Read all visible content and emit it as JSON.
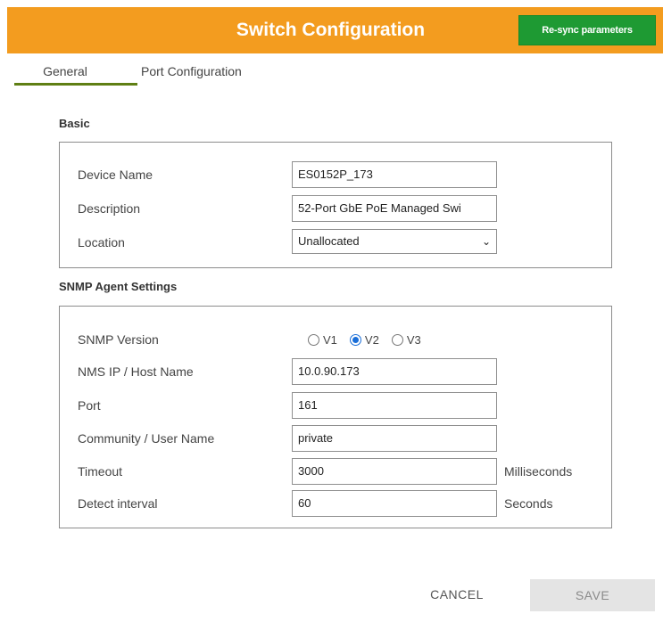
{
  "header": {
    "title": "Switch Configuration",
    "resync_label": "Re-sync parameters",
    "accent_color": "#f39c1f",
    "resync_color": "#1e9a33"
  },
  "tabs": [
    {
      "label": "General",
      "active": true
    },
    {
      "label": "Port Configuration",
      "active": false
    }
  ],
  "basic": {
    "title": "Basic",
    "device_name": {
      "label": "Device Name",
      "value": "ES0152P_173"
    },
    "description": {
      "label": "Description",
      "value": "52-Port GbE PoE Managed Swi"
    },
    "location": {
      "label": "Location",
      "value": "Unallocated",
      "icon": "chevron-down-icon"
    }
  },
  "snmp": {
    "title": "SNMP Agent Settings",
    "version": {
      "label": "SNMP Version",
      "options": [
        "V1",
        "V2",
        "V3"
      ],
      "selected": "V2"
    },
    "nms_ip": {
      "label": "NMS IP / Host Name",
      "value": "10.0.90.173"
    },
    "port": {
      "label": "Port",
      "value": "161"
    },
    "community": {
      "label": "Community / User Name",
      "value": "private"
    },
    "timeout": {
      "label": "Timeout",
      "value": "3000",
      "unit": "Milliseconds"
    },
    "detect_interval": {
      "label": "Detect interval",
      "value": "60",
      "unit": "Seconds"
    }
  },
  "footer": {
    "cancel_label": "CANCEL",
    "save_label": "SAVE"
  }
}
